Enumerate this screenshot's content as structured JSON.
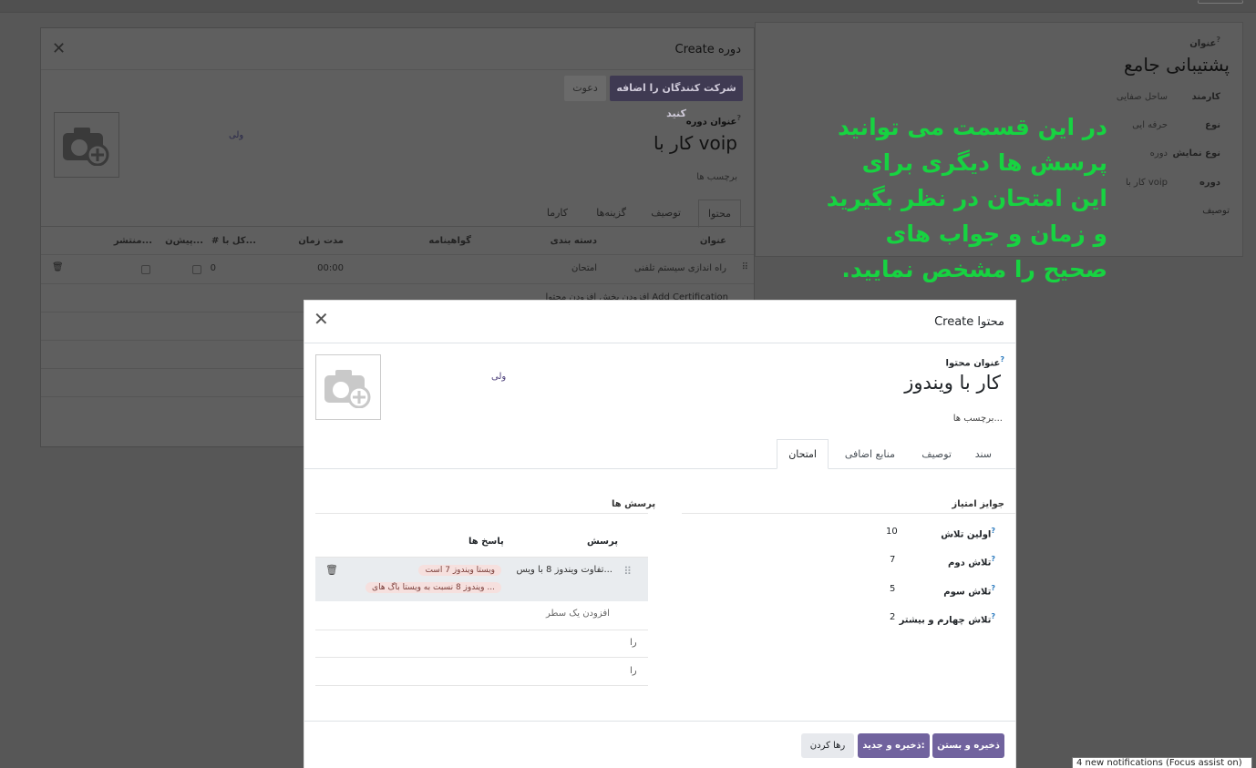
{
  "background_form": {
    "title_label": "عنوان",
    "title_value": "پشتیبانی جامع",
    "fields": [
      {
        "label": "کارمند",
        "value": "ساحل صفایی"
      },
      {
        "label": "نوع",
        "value": "حرفه ایی"
      },
      {
        "label": "نوع نمایش",
        "value": "دوره"
      },
      {
        "label": "دوره",
        "value": "کار با voip"
      },
      {
        "label": "توصیف",
        "value": ""
      }
    ]
  },
  "course_dialog": {
    "title": "Create دوره",
    "add_attendees_label": "شرکت کنندگان را اضافه کنید",
    "invite_label": "دعوت",
    "name_label": "عنوان دوره",
    "name_value": "کار با voip",
    "responsible": "ولی",
    "tags_placeholder": "برچسب ها",
    "tabs": [
      "محتوا",
      "توصیف",
      "گزینه‌ها",
      "کارما"
    ],
    "columns": [
      "عنوان",
      "دسته بندی",
      "گواهینامه",
      "مدت زمان",
      "# کل با...",
      "پیش‌ن...",
      "منتشر..."
    ],
    "row": {
      "title": "راه اندازی سیستم تلفنی",
      "category": "امتحان",
      "duration": "00:00",
      "count": "0"
    },
    "footer_links": "افزودن بخش  افزودن محتوا  Add Certification"
  },
  "hint_text": "در این قسمت می توانید پرسش ها دیگری برای این امتحان در نظر بگیرید و زمان و جواب های صحیح را مشخص نمایید.",
  "content_dialog": {
    "title": "Create محتوا",
    "name_label": "عنوان محتوا",
    "name_value": "کار با ویندوز",
    "responsible": "ولی",
    "tags_placeholder": "برچسب ها...",
    "tabs": [
      "سند",
      "توصیف",
      "منابع اضافی",
      "امتحان"
    ],
    "active_tab": "امتحان",
    "karma_section": "جوایز امتیاز",
    "karma": [
      {
        "label": "اولین تلاش",
        "value": "10"
      },
      {
        "label": "تلاش دوم",
        "value": "7"
      },
      {
        "label": "تلاش سوم",
        "value": "5"
      },
      {
        "label": "تلاش چهارم و بیشتر",
        "value": "2"
      }
    ],
    "questions_section": "پرسش ها",
    "questions_header": {
      "question": "پرسش",
      "answers": "پاسخ ها"
    },
    "question_row": {
      "question": "تفاوت ویندوز 8 با ویس...",
      "answers": [
        "ویستا ویندوز 7 است",
        "ویندوز 8 نسبت به ویستا باگ های ..."
      ]
    },
    "add_line": "افزودن یک سطر",
    "empty_rows": [
      "را",
      "را"
    ],
    "buttons": {
      "save_close": "ذخیره و بستن",
      "save_new": "ذخیره و جدید:",
      "discard": "رها کردن"
    }
  },
  "notification": "4 new notifications (Focus assist on)",
  "colors": {
    "primary": "#71639e",
    "hint": "#17d341",
    "badge_bg": "#f6e0de"
  }
}
